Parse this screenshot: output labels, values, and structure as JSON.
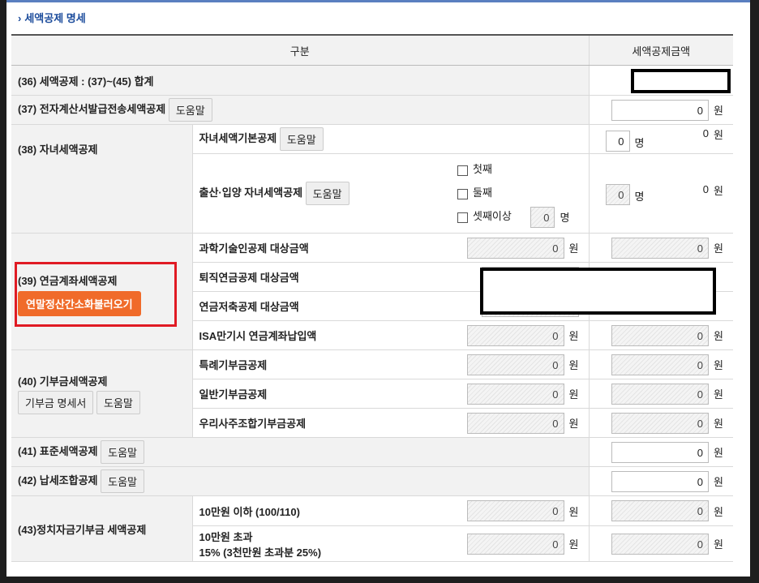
{
  "section_title": "세액공제 명세",
  "header": {
    "col1": "구분",
    "col2": "세액공제금액"
  },
  "unit_won": "원",
  "unit_person": "명",
  "help_label": "도움말",
  "rows": {
    "r36": {
      "label": "(36) 세액공제 : (37)~(45) 합계"
    },
    "r37": {
      "label": "(37) 전자계산서발급전송세액공제",
      "amount": "0"
    },
    "r38": {
      "label": "(38) 자녀세액공제",
      "basic": {
        "label": "자녀세액기본공제",
        "count": "0",
        "amount": "0"
      },
      "birth": {
        "label": "출산·입양 자녀세액공제",
        "options": [
          "첫째",
          "둘째",
          "셋째이상"
        ],
        "count": "0",
        "amount": "0"
      }
    },
    "r39": {
      "label": "(39) 연금계좌세액공제",
      "load_button": "연말정산간소화불러오기",
      "items": [
        {
          "label": "과학기술인공제 대상금액",
          "base": "0",
          "amount": "0"
        },
        {
          "label": "퇴직연금공제 대상금액",
          "base": "",
          "amount": ""
        },
        {
          "label": "연금저축공제 대상금액",
          "base": "",
          "amount": ""
        },
        {
          "label": "ISA만기시 연금계좌납입액",
          "base": "0",
          "amount": "0"
        }
      ]
    },
    "r40": {
      "label": "(40) 기부금세액공제",
      "donation_button": "기부금 명세서",
      "items": [
        {
          "label": "특례기부금공제",
          "base": "0",
          "amount": "0"
        },
        {
          "label": "일반기부금공제",
          "base": "0",
          "amount": "0"
        },
        {
          "label": "우리사주조합기부금공제",
          "base": "0",
          "amount": "0"
        }
      ]
    },
    "r41": {
      "label": "(41) 표준세액공제",
      "amount": "0"
    },
    "r42": {
      "label": "(42) 납세조합공제",
      "amount": "0"
    },
    "r43": {
      "label": "(43)정치자금기부금 세액공제",
      "items": [
        {
          "label": "10만원 이하 (100/110)",
          "base": "0",
          "amount": "0"
        },
        {
          "label": "10만원 초과",
          "label2": "15% (3천만원 초과분 25%)",
          "base": "0",
          "amount": "0"
        }
      ]
    }
  }
}
